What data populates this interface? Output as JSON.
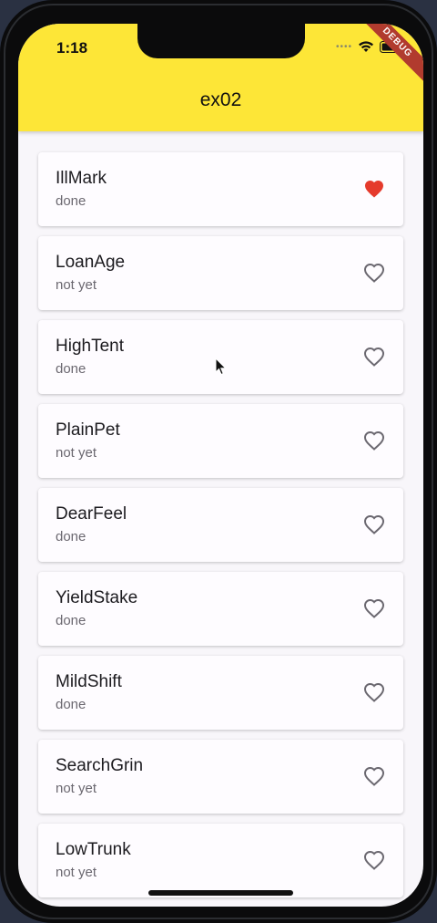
{
  "status_bar": {
    "time": "1:18",
    "debug_label": "DEBUG"
  },
  "app_bar": {
    "title": "ex02"
  },
  "colors": {
    "accent": "#fde637",
    "favorite": "#e53a2c",
    "icon_outline": "#6b6870"
  },
  "items": [
    {
      "title": "IllMark",
      "status": "done",
      "favorite": true
    },
    {
      "title": "LoanAge",
      "status": "not yet",
      "favorite": false
    },
    {
      "title": "HighTent",
      "status": "done",
      "favorite": false
    },
    {
      "title": "PlainPet",
      "status": "not yet",
      "favorite": false
    },
    {
      "title": "DearFeel",
      "status": "done",
      "favorite": false
    },
    {
      "title": "YieldStake",
      "status": "done",
      "favorite": false
    },
    {
      "title": "MildShift",
      "status": "done",
      "favorite": false
    },
    {
      "title": "SearchGrin",
      "status": "not yet",
      "favorite": false
    },
    {
      "title": "LowTrunk",
      "status": "not yet",
      "favorite": false
    }
  ]
}
